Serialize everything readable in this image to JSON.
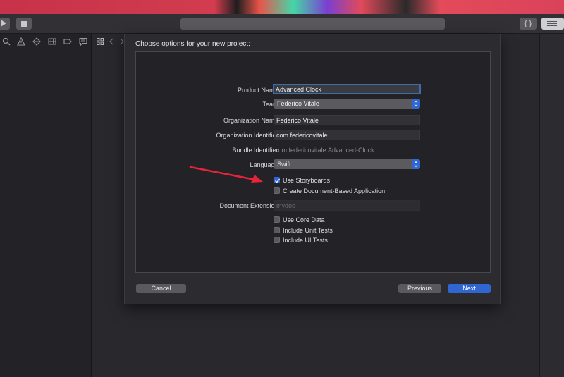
{
  "toolbar": {
    "run_icon": "play-icon",
    "stop_icon": "stop-icon",
    "library_label": "{}",
    "inspector_icon": "inspector-toggle-icon"
  },
  "navigator": {
    "icons": [
      "folder-icon",
      "source-control-icon",
      "symbol-icon",
      "search-icon",
      "warning-icon",
      "test-diamond-icon",
      "debug-grid-icon",
      "breakpoint-icon",
      "report-icon"
    ]
  },
  "editor": {
    "icons": [
      "grid-icon",
      "back-chevron-icon",
      "forward-chevron-icon"
    ]
  },
  "sheet": {
    "title": "Choose options for your new project:",
    "fields": {
      "product_name": {
        "label": "Product Name:",
        "value": "Advanced Clock"
      },
      "team": {
        "label": "Team:",
        "value": "Federico Vitale"
      },
      "organization_name": {
        "label": "Organization Name:",
        "value": "Federico Vitale"
      },
      "organization_identifier": {
        "label": "Organization Identifier:",
        "value": "com.federicovitale"
      },
      "bundle_identifier": {
        "label": "Bundle Identifier:",
        "value": "com.federicovitale.Advanced-Clock"
      },
      "language": {
        "label": "Language:",
        "value": "Swift"
      },
      "document_extension": {
        "label": "Document Extension:",
        "placeholder": "mydoc"
      }
    },
    "checkboxes": {
      "use_storyboards": {
        "label": "Use Storyboards",
        "checked": true
      },
      "create_document_based": {
        "label": "Create Document-Based Application",
        "checked": false
      },
      "use_core_data": {
        "label": "Use Core Data",
        "checked": false
      },
      "include_unit_tests": {
        "label": "Include Unit Tests",
        "checked": false
      },
      "include_ui_tests": {
        "label": "Include UI Tests",
        "checked": false
      }
    },
    "buttons": {
      "cancel": "Cancel",
      "previous": "Previous",
      "next": "Next"
    },
    "annotation_color": "#e5243b"
  }
}
